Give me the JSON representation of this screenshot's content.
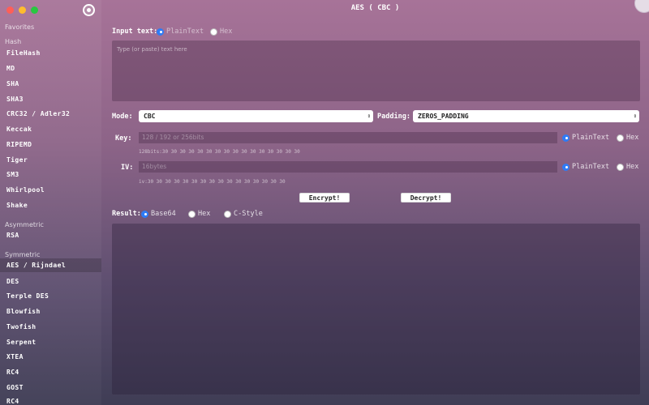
{
  "window": {
    "title": "AES ( CBC )"
  },
  "sidebar": {
    "sections": {
      "favorites": "Favorites",
      "hash": "Hash",
      "asymmetric": "Asymmetric",
      "symmetric": "Symmetric"
    },
    "hash_items": [
      "FileHash",
      "MD",
      "SHA",
      "SHA3",
      "CRC32 / Adler32",
      "Keccak",
      "RIPEMD",
      "Tiger",
      "SM3",
      "Whirlpool",
      "Shake"
    ],
    "asymmetric_items": [
      "RSA"
    ],
    "symmetric_items": [
      "AES / Rijndael",
      "DES",
      "Terple DES",
      "Blowfish",
      "Twofish",
      "Serpent",
      "XTEA",
      "RC4",
      "GOST",
      "RC4"
    ],
    "active_item": "AES / Rijndael"
  },
  "input": {
    "label": "Input text:",
    "options": [
      "PlainText",
      "Hex"
    ],
    "selected": "PlainText",
    "placeholder": "Type (or paste) text here"
  },
  "mode": {
    "label": "Mode:",
    "value": "CBC"
  },
  "padding": {
    "label": "Padding:",
    "value": "ZEROS_PADDING"
  },
  "key": {
    "label": "Key:",
    "placeholder": "128 / 192 or 256bits",
    "hint": "128bits:30 30 30 30 30 30 30 30 30 30 30 30 30 30 30 30",
    "options": [
      "PlainText",
      "Hex"
    ],
    "selected": "PlainText"
  },
  "iv": {
    "label": "IV:",
    "placeholder": "16bytes",
    "hint": "iv:30 30 30 30 30 30 30 30 30 30 30 30 30 30 30 30",
    "options": [
      "PlainText",
      "Hex"
    ],
    "selected": "PlainText"
  },
  "buttons": {
    "encrypt": "Encrypt!",
    "decrypt": "Decrypt!"
  },
  "result": {
    "label": "Result:",
    "options": [
      "Base64",
      "Hex",
      "C-Style"
    ],
    "selected": "Base64"
  }
}
